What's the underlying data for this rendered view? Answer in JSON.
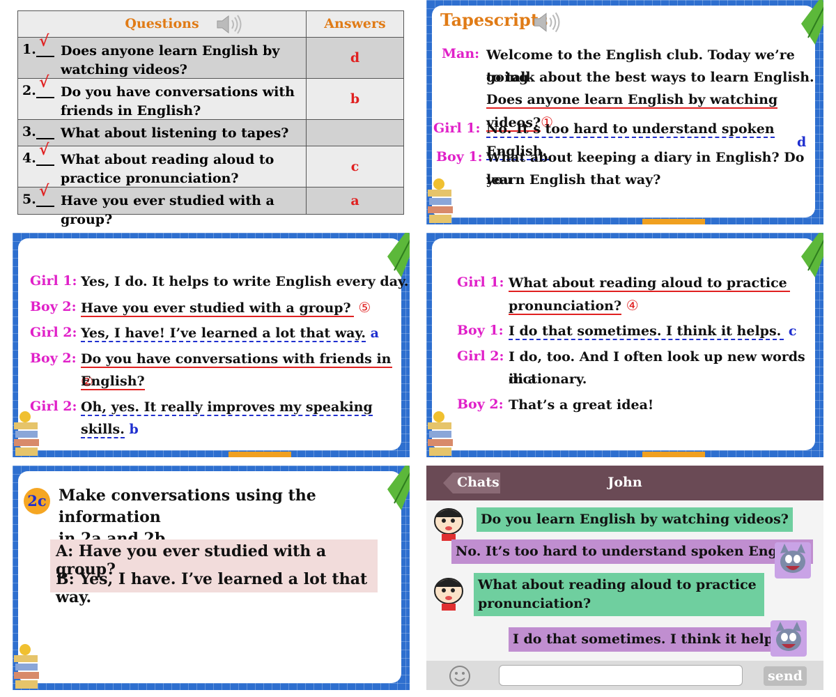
{
  "quiz": {
    "header_questions": "Questions",
    "header_answers": "Answers",
    "rows": [
      {
        "num": "1.",
        "tick": "√",
        "text": "Does anyone learn English by watching videos?",
        "answer": "d"
      },
      {
        "num": "2.",
        "tick": "√",
        "text": "Do you have conversations with friends in English?",
        "answer": "b"
      },
      {
        "num": "3.",
        "tick": "",
        "text": "What about listening to tapes?",
        "answer": ""
      },
      {
        "num": "4.",
        "tick": "√",
        "text": "What about reading aloud to practice pronunciation?",
        "answer": "c"
      },
      {
        "num": "5.",
        "tick": "√",
        "text": "Have you ever studied with a group?",
        "answer": "a"
      }
    ]
  },
  "tapescripts": {
    "title": "Tapescripts",
    "lines": [
      {
        "speaker": "Man:",
        "l1": "Welcome to the English club. Today we’re going",
        "l2": "to talk about the best ways to learn English.",
        "l3": "Does anyone learn English by watching videos?",
        "mark": "①"
      },
      {
        "speaker": "Girl 1:",
        "l1": "No. It’s too hard to understand spoken English.",
        "letter": "d"
      },
      {
        "speaker": "Boy 1:",
        "l1": "What about keeping a diary in English? Do you",
        "l2": "learn English that way?"
      }
    ]
  },
  "slide3": {
    "lines": [
      {
        "speaker": "Girl 1:",
        "text": "Yes, I do. It helps to write English every day."
      },
      {
        "speaker": "Boy 2:",
        "text": "Have you ever studied with a group?",
        "mark": "⑤"
      },
      {
        "speaker": "Girl 2:",
        "text": "Yes, I have! I’ve learned a lot that way.",
        "letter": "a"
      },
      {
        "speaker": "Boy 2:",
        "text": "Do you have conversations with friends in",
        "text2": "English?",
        "mark": "②"
      },
      {
        "speaker": "Girl 2:",
        "text": "Oh, yes. It really improves my speaking skills.",
        "letter": "b"
      }
    ]
  },
  "slide4": {
    "lines": [
      {
        "speaker": "Girl 1:",
        "text": "What about reading aloud to practice",
        "text2": "pronunciation?",
        "mark": "④"
      },
      {
        "speaker": "Boy 1:",
        "text": "I do that sometimes. I think it helps.",
        "letter": "c"
      },
      {
        "speaker": "Girl 2:",
        "text": "I do, too. And I often look up new words in a",
        "text2": "dictionary."
      },
      {
        "speaker": "Boy 2:",
        "text": "That’s a great idea!"
      }
    ]
  },
  "slide5": {
    "badge": "2c",
    "instruction_l1": "Make conversations using the information",
    "instruction_l2": "in 2a and 2b.",
    "line_a": "A: Have you ever studied with a group?",
    "line_b": "B: Yes, I have. I’ve learned a lot that way."
  },
  "chat": {
    "back_label": "Chats",
    "contact": "John",
    "messages": [
      {
        "from": "left",
        "text": "Do you learn English by watching videos?"
      },
      {
        "from": "right",
        "text": "No. It’s too hard to understand spoken English."
      },
      {
        "from": "left",
        "text": "What about reading aloud to practice",
        "text2": "pronunciation?"
      },
      {
        "from": "right",
        "text": "I do that sometimes. I think it helps."
      }
    ],
    "input_value": "",
    "send_label": "send",
    "colors": {
      "header": "#6a4a55",
      "left_bubble": "#6fcf9f",
      "right_bubble": "#c08ed0"
    }
  },
  "colors": {
    "slide_frame": "#2e6fcf",
    "speaker": "#e020c8",
    "accent_orange": "#e07b16",
    "red": "#e02020",
    "blue": "#1f2fcf"
  }
}
